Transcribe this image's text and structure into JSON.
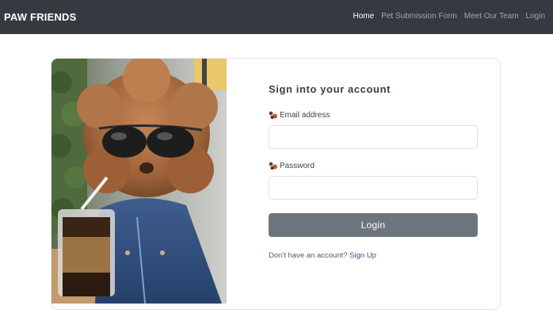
{
  "navbar": {
    "brand": "PAW FRIENDS",
    "links": [
      {
        "label": "Home",
        "active": true
      },
      {
        "label": "Pet Submission Form",
        "active": false
      },
      {
        "label": "Meet Our Team",
        "active": false
      },
      {
        "label": "Login",
        "active": false
      }
    ]
  },
  "login_card": {
    "image_icon": "poodle-with-sunglasses-photo",
    "title": "Sign into your account",
    "email": {
      "label": "Email address",
      "value": "",
      "icon": "paw-icon"
    },
    "password": {
      "label": "Password",
      "value": "",
      "icon": "paw-icon"
    },
    "submit_label": "Login",
    "signup_prompt": "Don't have an account?",
    "signup_link": "Sign Up"
  },
  "colors": {
    "navbar_bg": "#343a40",
    "button_bg": "#6c757d",
    "link": "#3d4f80"
  }
}
